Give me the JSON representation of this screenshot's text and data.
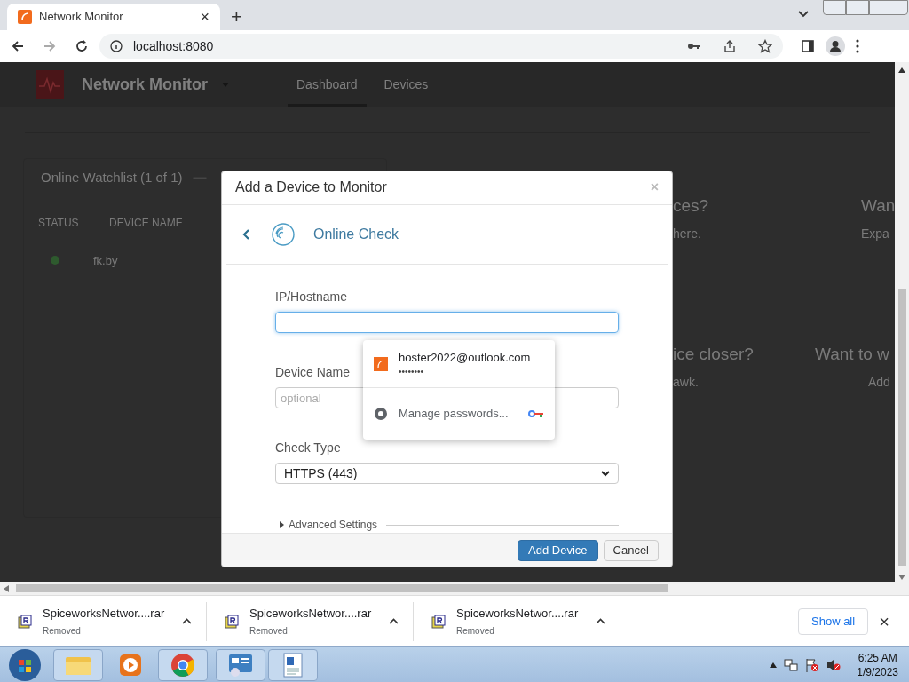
{
  "browser": {
    "tab": {
      "title": "Network Monitor",
      "close": "×"
    },
    "new_tab": "+",
    "url": "localhost:8080"
  },
  "page": {
    "app_title": "Network Monitor",
    "nav": [
      {
        "label": "Dashboard",
        "selected": true
      },
      {
        "label": "Devices",
        "selected": false
      }
    ],
    "watchlist": {
      "title": "Online Watchlist (1 of 1)",
      "collapse": "—",
      "columns": [
        "STATUS",
        "DEVICE NAME"
      ],
      "rows": [
        {
          "color": "#2e5a2e",
          "name": "fk.by"
        }
      ]
    },
    "tips": [
      {
        "title": "ces?",
        "text": "here."
      },
      {
        "title": "Wan",
        "text": "Expa"
      },
      {
        "title": "ice closer?",
        "text": "awk."
      },
      {
        "title": "Want to w",
        "text": "Add"
      }
    ]
  },
  "modal": {
    "title": "Add a Device to Monitor",
    "close": "×",
    "step": "Online Check",
    "fields": [
      {
        "kind": "text",
        "label": "IP/Hostname",
        "focused": true
      },
      {
        "kind": "text",
        "label": "Device Name",
        "placeholder": "optional",
        "focused": false
      },
      {
        "kind": "select",
        "label": "Check Type",
        "value": "HTTPS (443)",
        "focused": false
      }
    ],
    "advanced": "Advanced Settings",
    "buttons": [
      {
        "label": "Add Device",
        "kind": "primary"
      },
      {
        "label": "Cancel",
        "kind": "default"
      }
    ]
  },
  "password_popup": {
    "account": "hoster2022@outlook.com",
    "password": "••••••••",
    "manage": "Manage passwords..."
  },
  "downloads": {
    "items": [
      {
        "filename": "SpiceworksNetwor....rar",
        "status": "Removed"
      },
      {
        "filename": "SpiceworksNetwor....rar",
        "status": "Removed"
      },
      {
        "filename": "SpiceworksNetwor....rar",
        "status": "Removed"
      }
    ],
    "show_all": "Show all",
    "close": "×"
  },
  "taskbar": {
    "time": "6:25 AM",
    "date": "1/9/2023"
  }
}
